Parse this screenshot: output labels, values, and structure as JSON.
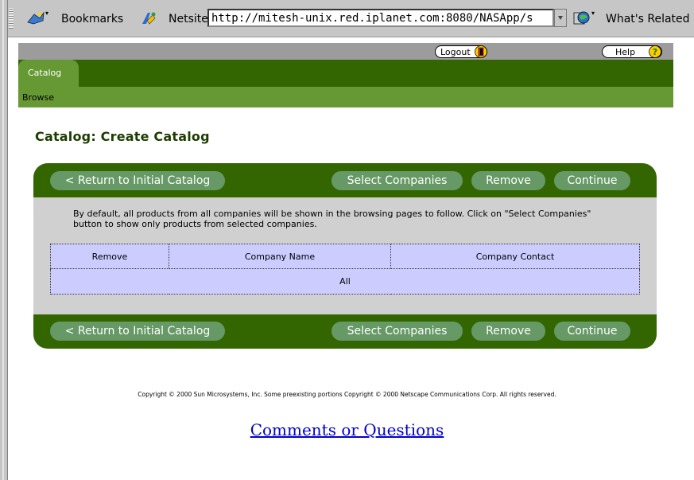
{
  "browser": {
    "bookmarks_label": "Bookmarks",
    "netsite_label": "Netsite:",
    "url": "http://mitesh-unix.red.iplanet.com:8080/NASApp/s",
    "whats_related_label": "What's Related"
  },
  "header": {
    "logout_label": "Logout",
    "help_label": "Help",
    "tab_label": "Catalog",
    "sub_nav_label": "Browse"
  },
  "page": {
    "title": "Catalog: Create Catalog",
    "description": "By default, all products from all companies will be shown in the browsing pages to follow. Click on \"Select Companies\" button to show only products from selected companies."
  },
  "toolbar": {
    "return_label": "< Return to Initial Catalog",
    "select_companies_label": "Select Companies",
    "remove_label": "Remove",
    "continue_label": "Continue"
  },
  "table": {
    "columns": [
      "Remove",
      "Company Name",
      "Company Contact"
    ],
    "rows": [
      "All"
    ]
  },
  "footer": {
    "copyright": "Copyright © 2000 Sun Microsystems, Inc. Some preexisting portions Copyright © 2000 Netscape Communications Corp. All rights reserved.",
    "comments_link": "Comments or Questions"
  },
  "colors": {
    "dark_green": "#336600",
    "light_green": "#669933",
    "button_green": "#669966",
    "table_blue": "#ccccff",
    "panel_gray": "#d0d0d0",
    "link_blue": "#0000cc"
  }
}
